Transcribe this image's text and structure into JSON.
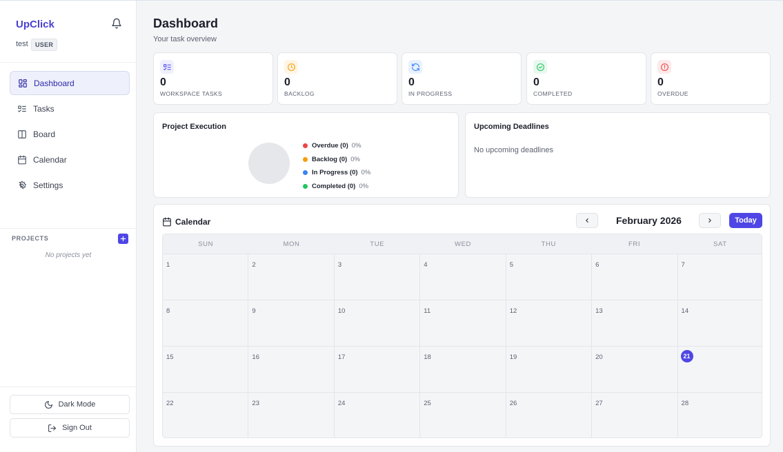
{
  "app": {
    "brand": "UpClick",
    "user_name": "test",
    "role": "USER"
  },
  "nav": [
    {
      "label": "Dashboard",
      "icon": "dashboard-icon",
      "active": true
    },
    {
      "label": "Tasks",
      "icon": "tasks-icon",
      "active": false
    },
    {
      "label": "Board",
      "icon": "board-icon",
      "active": false
    },
    {
      "label": "Calendar",
      "icon": "calendar-icon",
      "active": false
    },
    {
      "label": "Settings",
      "icon": "gear-icon",
      "active": false
    }
  ],
  "projects": {
    "label": "PROJECTS",
    "empty_text": "No projects yet"
  },
  "footer": {
    "dark_mode_label": "Dark Mode",
    "sign_out_label": "Sign Out"
  },
  "header": {
    "title": "Dashboard",
    "subtitle": "Your task overview"
  },
  "stats": [
    {
      "value": "0",
      "label": "WORKSPACE TASKS",
      "icon": "task-list-icon",
      "color": "#4f46e5"
    },
    {
      "value": "0",
      "label": "BACKLOG",
      "icon": "clock-icon",
      "color": "#f59e0b"
    },
    {
      "value": "0",
      "label": "IN PROGRESS",
      "icon": "refresh-icon",
      "color": "#3b82f6"
    },
    {
      "value": "0",
      "label": "COMPLETED",
      "icon": "check-circle-icon",
      "color": "#22c55e"
    },
    {
      "value": "0",
      "label": "OVERDUE",
      "icon": "alert-circle-icon",
      "color": "#ef4444"
    }
  ],
  "project_execution": {
    "title": "Project Execution",
    "legend": [
      {
        "name": "Overdue (0)",
        "pct": "0%",
        "color": "#ef4444"
      },
      {
        "name": "Backlog (0)",
        "pct": "0%",
        "color": "#f59e0b"
      },
      {
        "name": "In Progress (0)",
        "pct": "0%",
        "color": "#3b82f6"
      },
      {
        "name": "Completed (0)",
        "pct": "0%",
        "color": "#22c55e"
      }
    ]
  },
  "deadlines": {
    "title": "Upcoming Deadlines",
    "empty_text": "No upcoming deadlines"
  },
  "calendar": {
    "title": "Calendar",
    "month": "February 2026",
    "today_label": "Today",
    "today": "21",
    "weekdays": [
      "SUN",
      "MON",
      "TUE",
      "WED",
      "THU",
      "FRI",
      "SAT"
    ],
    "weeks": [
      [
        "1",
        "2",
        "3",
        "4",
        "5",
        "6",
        "7"
      ],
      [
        "8",
        "9",
        "10",
        "11",
        "12",
        "13",
        "14"
      ],
      [
        "15",
        "16",
        "17",
        "18",
        "19",
        "20",
        "21"
      ],
      [
        "22",
        "23",
        "24",
        "25",
        "26",
        "27",
        "28"
      ]
    ]
  }
}
